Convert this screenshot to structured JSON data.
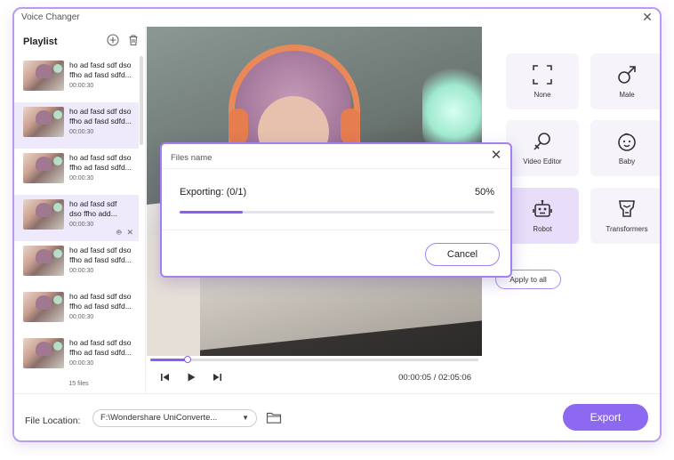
{
  "window": {
    "title": "Voice  Changer"
  },
  "playlist": {
    "title": "Playlist",
    "count_label": "15 files",
    "items": [
      {
        "name": "ho ad fasd sdf dso\nffho ad fasd sdfd...",
        "duration": "00:00:30",
        "active": false
      },
      {
        "name": "ho ad fasd sdf dso\nffho ad fasd sdfd...",
        "duration": "00:00:30",
        "active": true
      },
      {
        "name": "ho ad fasd sdf dso\nffho ad fasd sdfd...",
        "duration": "00:00:30",
        "active": false
      },
      {
        "name": "ho ad fasd sdf\ndso  ffho add...",
        "duration": "00:00:30",
        "active": true
      },
      {
        "name": "ho ad fasd sdf dso\nffho ad fasd sdfd...",
        "duration": "00:00:30",
        "active": false
      },
      {
        "name": "ho ad fasd sdf dso\nffho ad fasd sdfd...",
        "duration": "00:00:30",
        "active": false
      },
      {
        "name": "ho ad fasd sdf dso\nffho ad fasd sdfd...",
        "duration": "00:00:30",
        "active": false
      }
    ]
  },
  "player": {
    "time": "00:00:05 / 02:05:06",
    "progress": 0.115
  },
  "effects": {
    "items": [
      {
        "label": "None",
        "icon": "none-frame-icon",
        "selected": false
      },
      {
        "label": "Male",
        "icon": "male-icon",
        "selected": false
      },
      {
        "label": "Video Editor",
        "icon": "female-icon",
        "selected": false
      },
      {
        "label": "Baby",
        "icon": "baby-icon",
        "selected": false
      },
      {
        "label": "Robot",
        "icon": "robot-icon",
        "selected": true
      },
      {
        "label": "Transformers",
        "icon": "transformers-icon",
        "selected": false
      }
    ],
    "apply_all_label": "Apply to all"
  },
  "footer": {
    "file_location_label": "File Location:",
    "path": "F:\\Wondershare UniConverte...",
    "export_label": "Export"
  },
  "dialog": {
    "title": "Files name",
    "status": "Exporting: (0/1)",
    "percent_label": "50%",
    "progress": 0.2,
    "cancel_label": "Cancel"
  },
  "colors": {
    "accent": "#8d68f0",
    "accent_border": "#b99bf0",
    "selected_bg": "#e8defa"
  }
}
